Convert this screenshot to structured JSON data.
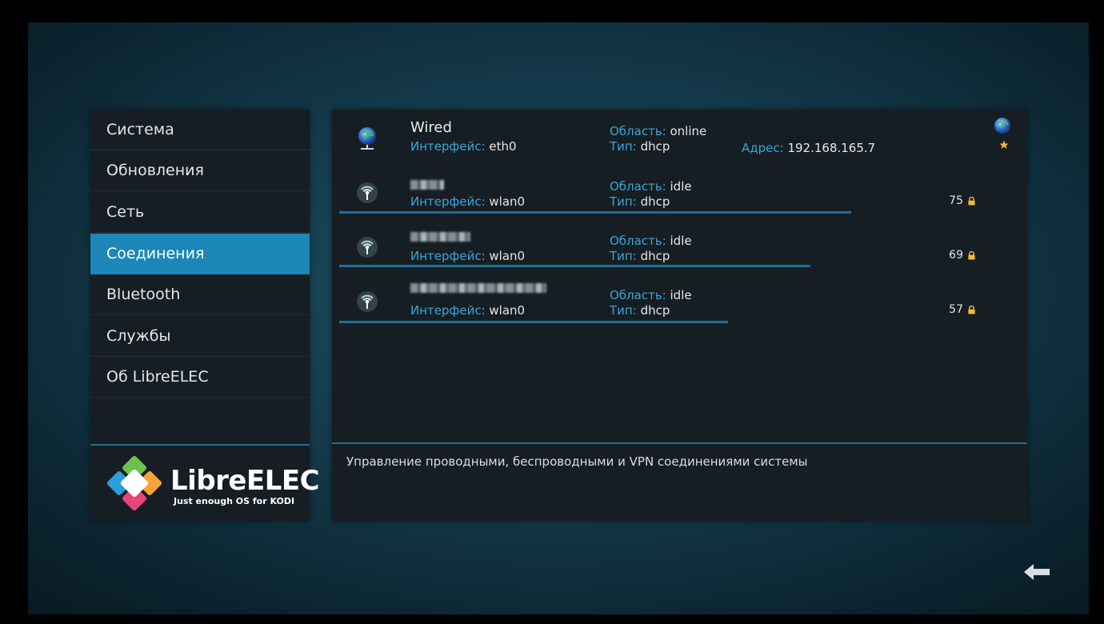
{
  "sidebar": {
    "items": [
      {
        "label": "Система",
        "selected": false
      },
      {
        "label": "Обновления",
        "selected": false
      },
      {
        "label": "Сеть",
        "selected": false
      },
      {
        "label": "Соединения",
        "selected": true
      },
      {
        "label": "Bluetooth",
        "selected": false
      },
      {
        "label": "Службы",
        "selected": false
      },
      {
        "label": "Об LibreELEC",
        "selected": false
      }
    ],
    "logo": {
      "name": "LibreELEC",
      "tagline": "Just enough OS for KODI"
    }
  },
  "labels": {
    "interface": "Интерфейс:",
    "state": "Область:",
    "type": "Тип:",
    "address": "Адрес:"
  },
  "connections": [
    {
      "name": "Wired",
      "icon": "wired-globe-icon",
      "interface": "eth0",
      "state": "online",
      "type": "dhcp",
      "address": "192.168.165.7",
      "strength": null,
      "favorite": true,
      "connected": true
    },
    {
      "name": "",
      "icon": "wifi-icon",
      "interface": "wlan0",
      "state": "idle",
      "type": "dhcp",
      "strength": "75",
      "signal_fraction": 0.75
    },
    {
      "name": "",
      "icon": "wifi-icon",
      "interface": "wlan0",
      "state": "idle",
      "type": "dhcp",
      "strength": "69",
      "signal_fraction": 0.69
    },
    {
      "name": "",
      "icon": "wifi-icon",
      "interface": "wlan0",
      "state": "idle",
      "type": "dhcp",
      "strength": "57",
      "signal_fraction": 0.57
    }
  ],
  "description": "Управление проводными, беспроводными и VPN соединениями системы",
  "colors": {
    "accent": "#1c87b8",
    "label_blue": "#3aa6d8",
    "panel": "#161e24"
  }
}
